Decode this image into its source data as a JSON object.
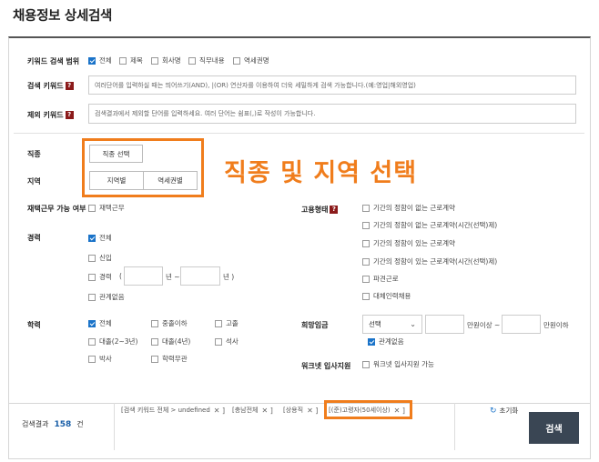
{
  "page_title": "채용정보 상세검색",
  "keyword_scope": {
    "label": "키워드 검색 범위",
    "options": [
      {
        "label": "전체",
        "checked": true
      },
      {
        "label": "제목",
        "checked": false
      },
      {
        "label": "회사명",
        "checked": false
      },
      {
        "label": "직무내용",
        "checked": false
      },
      {
        "label": "역세권명",
        "checked": false
      }
    ]
  },
  "search_keyword": {
    "label": "검색 키워드",
    "help": "?",
    "placeholder": "여러단어를 입력하실 때는 띄어쓰기(AND), |(OR) 연산자를 이용하여 더욱 세밀하게 검색 가능합니다.(예:영업|해외영업)"
  },
  "exclude_keyword": {
    "label": "제외 키워드",
    "help": "?",
    "placeholder": "검색결과에서 제외할 단어를 입력하세요. 여러 단어는 쉼표(,)로 작성이 가능합니다."
  },
  "job_type": {
    "label": "직종",
    "button": "직종 선택"
  },
  "region": {
    "label": "지역",
    "button_region": "지역별",
    "button_station": "역세권별"
  },
  "overlay_text": "직종 및 지역 선택",
  "remote": {
    "label": "재택근무 가능 여부",
    "option": "재택근무"
  },
  "employment_type": {
    "label": "고용형태",
    "help": "?",
    "options": [
      {
        "label": "기간의 정함이 없는 근로계약",
        "checked": false
      },
      {
        "label": "기간의 정함이 없는 근로계약(시간(선택)제)",
        "checked": false
      },
      {
        "label": "기간의 정함이 있는 근로계약",
        "checked": false
      },
      {
        "label": "기간의 정함이 있는 근로계약(시간(선택)제)",
        "checked": false
      },
      {
        "label": "파견근로",
        "checked": false
      },
      {
        "label": "대체인력채용",
        "checked": false
      }
    ]
  },
  "career": {
    "label": "경력",
    "opt_all": "전체",
    "opt_new": "신입",
    "opt_exp": "경력",
    "paren_open": "(",
    "year_unit1": "년 ~",
    "year_unit2": "년 )",
    "opt_any": "관계없음"
  },
  "education": {
    "label": "학력",
    "options": [
      {
        "label": "전체",
        "checked": true
      },
      {
        "label": "중졸이하",
        "checked": false
      },
      {
        "label": "고졸",
        "checked": false
      },
      {
        "label": "대졸(2~3년)",
        "checked": false
      },
      {
        "label": "대졸(4년)",
        "checked": false
      },
      {
        "label": "석사",
        "checked": false
      },
      {
        "label": "박사",
        "checked": false
      },
      {
        "label": "학력무관",
        "checked": false
      }
    ]
  },
  "salary": {
    "label": "희망임금",
    "select_value": "선택",
    "min_unit": "만원이상 ~",
    "max_unit": "만원이하",
    "any_label": "관계없음",
    "any_checked": true
  },
  "worknet": {
    "label": "워크넷 입사지원",
    "option": "워크넷 입사지원 가능"
  },
  "results": {
    "label": "검색결과",
    "count": "158",
    "unit": "건",
    "tags": [
      "[검색 키워드 전체 > undefined",
      "[충남전체",
      "[상용직",
      "[(준)고령자(50세이상)"
    ],
    "close_glyph": "✕ ]",
    "reset_label": "초기화",
    "search_button": "검색"
  },
  "colors": {
    "accent": "#f07d1c",
    "check_blue": "#1a73c9",
    "help_red": "#8b1a1a",
    "count_blue": "#1a5fa8",
    "search_btn": "#3a4654"
  }
}
